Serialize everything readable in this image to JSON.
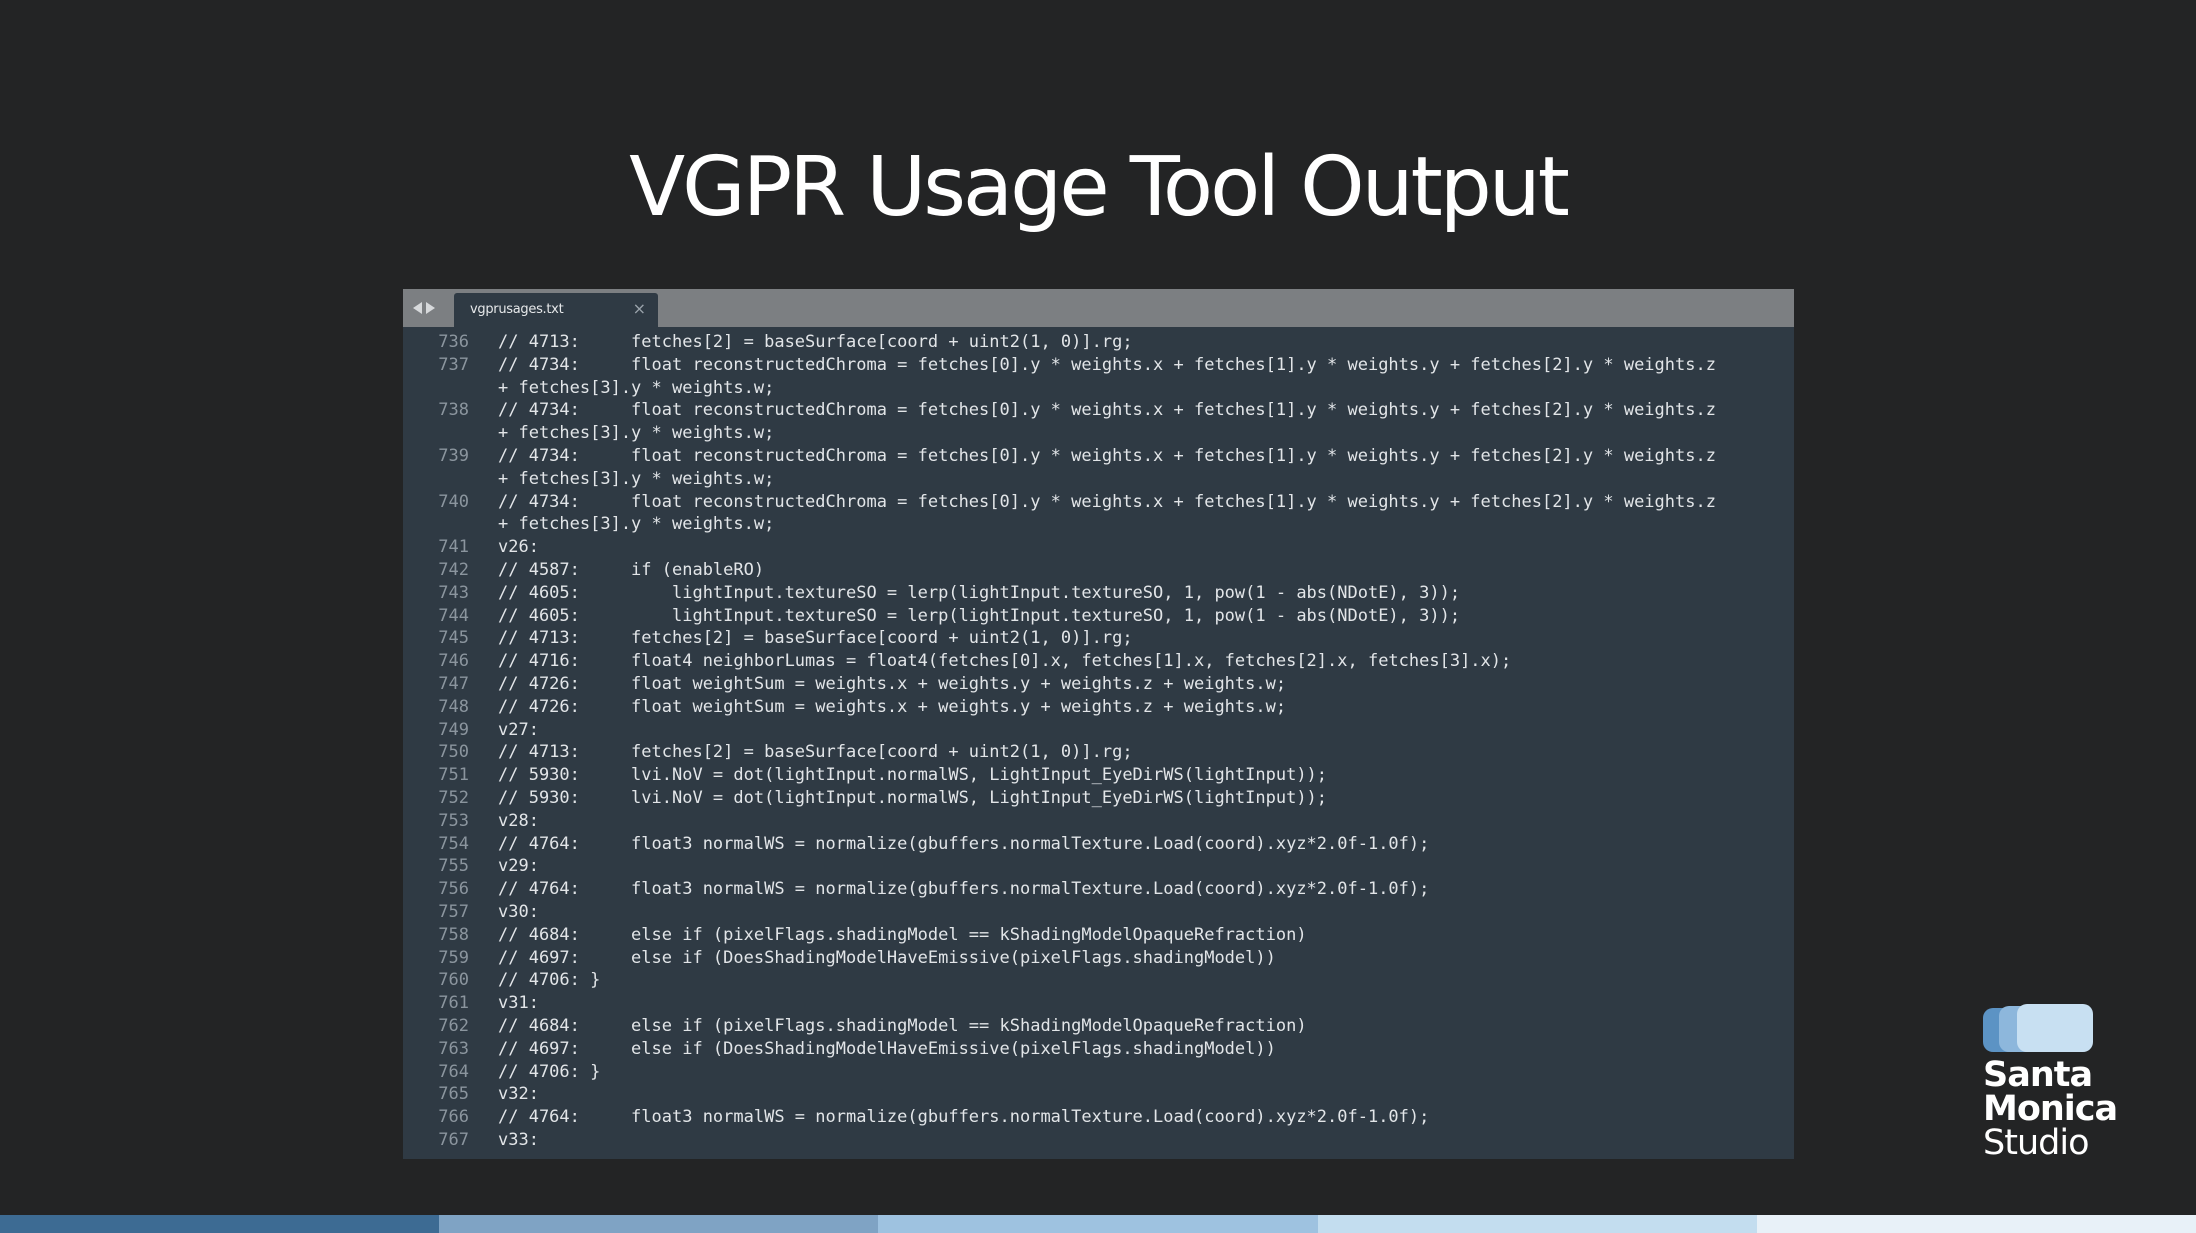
{
  "slide": {
    "title": "VGPR Usage Tool Output"
  },
  "editor": {
    "tab": {
      "label": "vgprusages.txt",
      "close_glyph": "×"
    },
    "rows": [
      {
        "ln": "736",
        "text": "// 4713:     fetches[2] = baseSurface[coord + uint2(1, 0)].rg;"
      },
      {
        "ln": "737",
        "text": "// 4734:     float reconstructedChroma = fetches[0].y * weights.x + fetches[1].y * weights.y + fetches[2].y * weights.z"
      },
      {
        "ln": "",
        "text": "+ fetches[3].y * weights.w;"
      },
      {
        "ln": "738",
        "text": "// 4734:     float reconstructedChroma = fetches[0].y * weights.x + fetches[1].y * weights.y + fetches[2].y * weights.z"
      },
      {
        "ln": "",
        "text": "+ fetches[3].y * weights.w;"
      },
      {
        "ln": "739",
        "text": "// 4734:     float reconstructedChroma = fetches[0].y * weights.x + fetches[1].y * weights.y + fetches[2].y * weights.z"
      },
      {
        "ln": "",
        "text": "+ fetches[3].y * weights.w;"
      },
      {
        "ln": "740",
        "text": "// 4734:     float reconstructedChroma = fetches[0].y * weights.x + fetches[1].y * weights.y + fetches[2].y * weights.z"
      },
      {
        "ln": "",
        "text": "+ fetches[3].y * weights.w;"
      },
      {
        "ln": "741",
        "text": "v26:"
      },
      {
        "ln": "742",
        "text": "// 4587:     if (enableRO)"
      },
      {
        "ln": "743",
        "text": "// 4605:         lightInput.textureSO = lerp(lightInput.textureSO, 1, pow(1 - abs(NDotE), 3));"
      },
      {
        "ln": "744",
        "text": "// 4605:         lightInput.textureSO = lerp(lightInput.textureSO, 1, pow(1 - abs(NDotE), 3));"
      },
      {
        "ln": "745",
        "text": "// 4713:     fetches[2] = baseSurface[coord + uint2(1, 0)].rg;"
      },
      {
        "ln": "746",
        "text": "// 4716:     float4 neighborLumas = float4(fetches[0].x, fetches[1].x, fetches[2].x, fetches[3].x);"
      },
      {
        "ln": "747",
        "text": "// 4726:     float weightSum = weights.x + weights.y + weights.z + weights.w;"
      },
      {
        "ln": "748",
        "text": "// 4726:     float weightSum = weights.x + weights.y + weights.z + weights.w;"
      },
      {
        "ln": "749",
        "text": "v27:"
      },
      {
        "ln": "750",
        "text": "// 4713:     fetches[2] = baseSurface[coord + uint2(1, 0)].rg;"
      },
      {
        "ln": "751",
        "text": "// 5930:     lvi.NoV = dot(lightInput.normalWS, LightInput_EyeDirWS(lightInput));"
      },
      {
        "ln": "752",
        "text": "// 5930:     lvi.NoV = dot(lightInput.normalWS, LightInput_EyeDirWS(lightInput));"
      },
      {
        "ln": "753",
        "text": "v28:"
      },
      {
        "ln": "754",
        "text": "// 4764:     float3 normalWS = normalize(gbuffers.normalTexture.Load(coord).xyz*2.0f-1.0f);"
      },
      {
        "ln": "755",
        "text": "v29:"
      },
      {
        "ln": "756",
        "text": "// 4764:     float3 normalWS = normalize(gbuffers.normalTexture.Load(coord).xyz*2.0f-1.0f);"
      },
      {
        "ln": "757",
        "text": "v30:"
      },
      {
        "ln": "758",
        "text": "// 4684:     else if (pixelFlags.shadingModel == kShadingModelOpaqueRefraction)"
      },
      {
        "ln": "759",
        "text": "// 4697:     else if (DoesShadingModelHaveEmissive(pixelFlags.shadingModel))"
      },
      {
        "ln": "760",
        "text": "// 4706: }"
      },
      {
        "ln": "761",
        "text": "v31:"
      },
      {
        "ln": "762",
        "text": "// 4684:     else if (pixelFlags.shadingModel == kShadingModelOpaqueRefraction)"
      },
      {
        "ln": "763",
        "text": "// 4697:     else if (DoesShadingModelHaveEmissive(pixelFlags.shadingModel))"
      },
      {
        "ln": "764",
        "text": "// 4706: }"
      },
      {
        "ln": "765",
        "text": "v32:"
      },
      {
        "ln": "766",
        "text": "// 4764:     float3 normalWS = normalize(gbuffers.normalTexture.Load(coord).xyz*2.0f-1.0f);"
      },
      {
        "ln": "767",
        "text": "v33:"
      }
    ]
  },
  "logo": {
    "line1": "Santa",
    "line2": "Monica",
    "line3": "Studio"
  },
  "colors": {
    "background": "#232425",
    "editor_bg": "#2f3a44",
    "tabbar_bg": "#7c7f82",
    "footer": [
      "#3d6b93",
      "#7fa3c4",
      "#9ec2e0",
      "#c3ddef",
      "#e8f1f8"
    ]
  }
}
